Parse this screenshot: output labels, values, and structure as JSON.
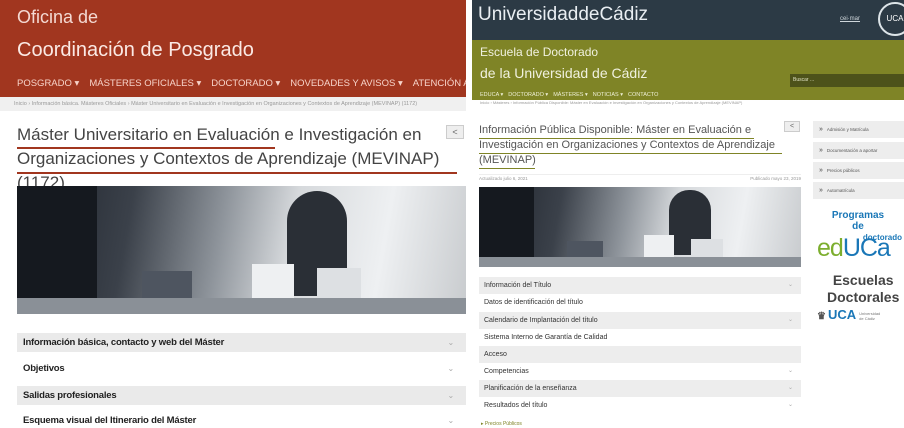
{
  "left": {
    "office": "Oficina de",
    "coordination": "Coordinación de Posgrado",
    "nav": [
      "POSGRADO ▾",
      "MÁSTERES OFICIALES ▾",
      "DOCTORADO ▾",
      "NOVEDADES Y AVISOS ▾",
      "ATENCIÓN AL USUARIO ▾"
    ],
    "breadcrumb": "Inicio › Información básica. Másteres Oficiales › Máster Universitario en Evaluación e Investigación en Organizaciones y Contextos de Aprendizaje (MEVINAP) (1172)",
    "title": "Máster Universitario en Evaluación e Investigación en Organizaciones y Contextos de Aprendizaje (MEVINAP) (1172)",
    "share_icon": "<",
    "accordion": [
      "Información básica, contacto y web del Máster",
      "Objetivos",
      "Salidas profesionales",
      "Esquema visual del Itinerario del Máster"
    ],
    "chevron": "⌄"
  },
  "right": {
    "university": "UniversidaddeCádiz",
    "cei": "cei·mar",
    "logo": "UCA",
    "school_line1": "Escuela de Doctorado",
    "school_line2": "de la Universidad de Cádiz",
    "search_placeholder": "Buscar ...",
    "nav": [
      "EDUCA ▾",
      "DOCTORADO ▾",
      "MÁSTERES ▾",
      "NOTICIAS ▾",
      "CONTACTO"
    ],
    "breadcrumb": "Inicio › Másteres › Información Pública Disponible: Máster en Evaluación e Investigación en Organizaciones y Contextos de Aprendizaje (MEVINAP)",
    "title": "Información Pública Disponible: Máster en Evaluación e Investigación en Organizaciones y Contextos de Aprendizaje (MEVINAP)",
    "updated": "Actualizado julio 6, 2021",
    "published": "Publicado mayo 23, 2019",
    "share_icon": "<",
    "accordion": [
      "Información del Título",
      "Datos de identificación del título",
      "Calendario de Implantación del título",
      "Sistema Interno de Garantía de Calidad",
      "Acceso",
      "Competencias",
      "Planificación de la enseñanza",
      "Resultados del título"
    ],
    "more": "▸ Precios Públicos",
    "sidebar": [
      "Admisión y Matrícula",
      "Documentación a aportar",
      "Precios públicos",
      "Automatrícula"
    ],
    "sidebar_arrow": "»",
    "programs_line1": "Programas",
    "programs_line2": "de",
    "programs_line3": "doctorado",
    "educa_e": "ed",
    "educa_rest": "UCa",
    "escuelas": "Escuelas",
    "doctorales": "Doctorales",
    "uca": "UCA",
    "uca_small": "Universidad de Cádiz"
  },
  "colors": {
    "left_header": "#a1361f",
    "right_top": "#2c3a45",
    "right_band": "#7f8426",
    "accent_blue": "#1a77b7"
  }
}
